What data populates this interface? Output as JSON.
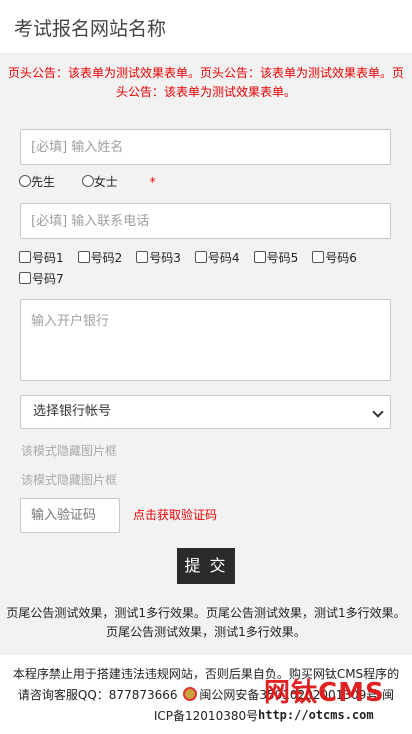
{
  "header": {
    "title": "考试报名网站名称"
  },
  "notice_top": "页头公告：该表单为测试效果表单。页头公告：该表单为测试效果表单。页头公告：该表单为测试效果表单。",
  "form": {
    "name_placeholder": "[必填] 输入姓名",
    "gender": {
      "male": "先生",
      "female": "女士",
      "required_mark": "*"
    },
    "phone_placeholder": "[必填] 输入联系电话",
    "numbers": [
      "号码1",
      "号码2",
      "号码3",
      "号码4",
      "号码5",
      "号码6",
      "号码7"
    ],
    "bank_placeholder": "输入开户银行",
    "bank_account_select": "选择银行帐号",
    "hidden_image_box_1": "该模式隐藏图片框",
    "hidden_image_box_2": "该模式隐藏图片框",
    "captcha_placeholder": "输入验证码",
    "captcha_link": "点击获取验证码",
    "submit_label": "提 交"
  },
  "notice_bottom": "页尾公告测试效果，测试1多行效果。页尾公告测试效果，测试1多行效果。页尾公告测试效果，测试1多行效果。",
  "footer": {
    "line1": "本程序禁止用于搭建违法违规网站，否则后果自负。购买网钛CMS程序的请咨询客服QQ：877873666",
    "police": "闽公网安备35010202001309号",
    "icp": "闽ICP备12010380号"
  },
  "watermark": {
    "brand": "网钛CMS",
    "url": "http://otcms.com"
  },
  "colors": {
    "accent_red": "#e60000",
    "submit_bg": "#2b2b2b",
    "page_bg": "#f2f2f2"
  }
}
